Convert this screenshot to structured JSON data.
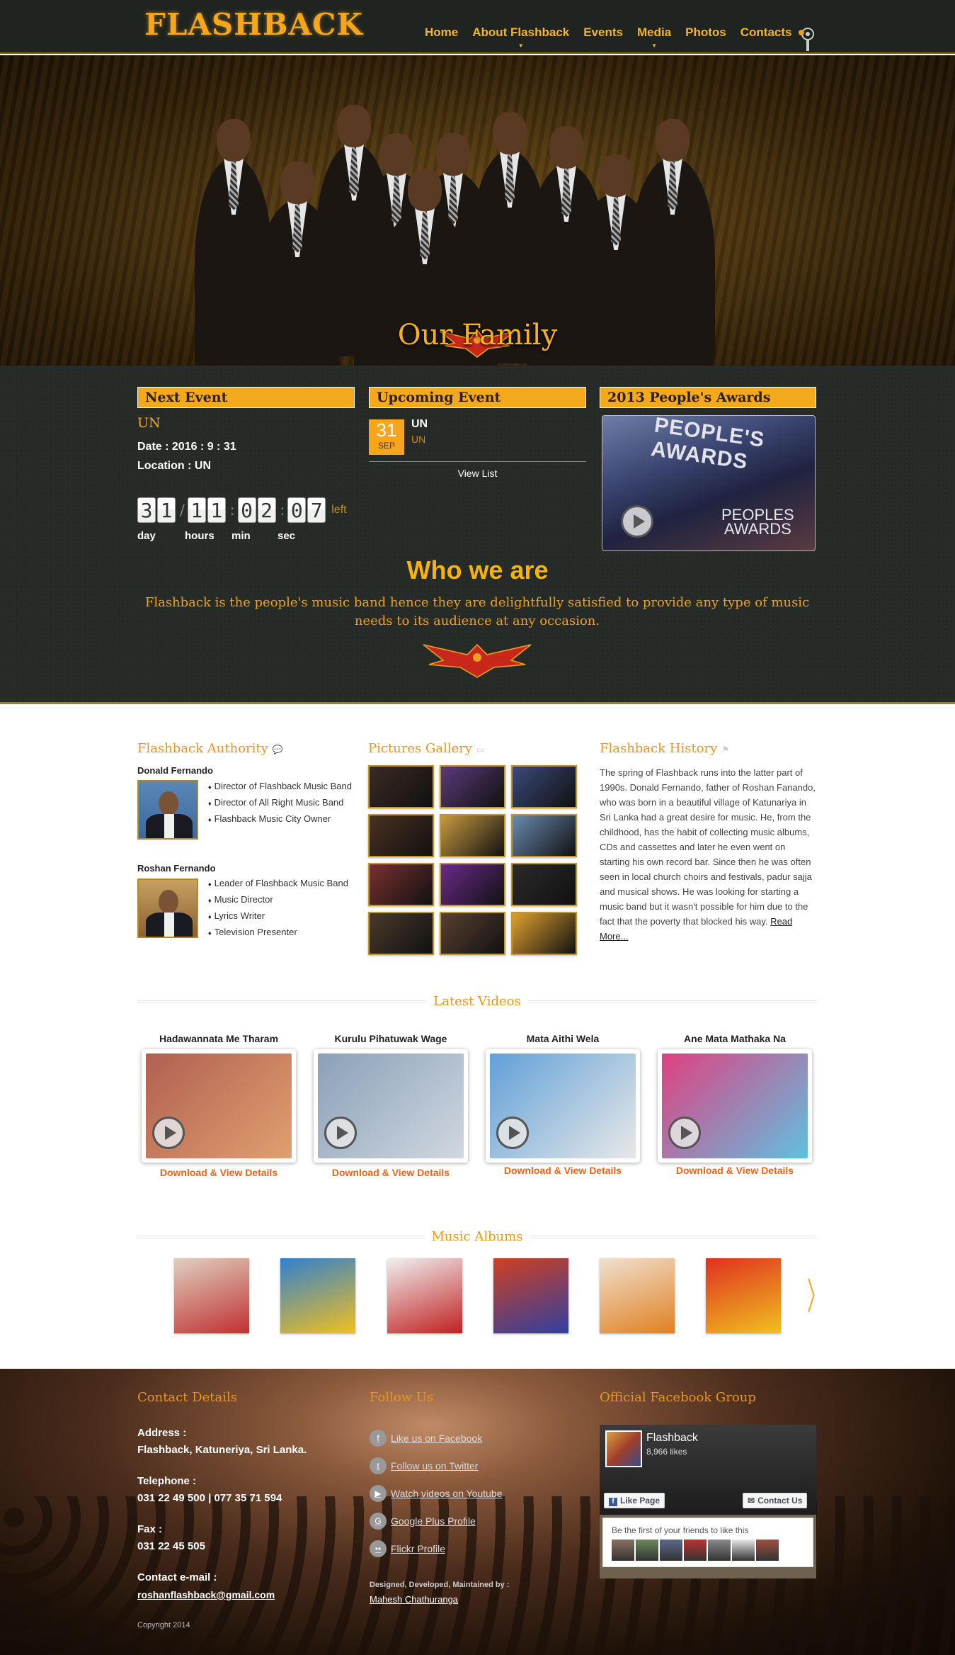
{
  "header": {
    "logo": "FLASHBACK",
    "nav": [
      {
        "label": "Home",
        "dropdown": false
      },
      {
        "label": "About Flashback",
        "dropdown": true
      },
      {
        "label": "Events",
        "dropdown": false
      },
      {
        "label": "Media",
        "dropdown": true
      },
      {
        "label": "Photos",
        "dropdown": false
      },
      {
        "label": "Contacts",
        "dropdown": false
      }
    ],
    "settings_icon": "gear-key-icon"
  },
  "hero": {
    "caption": "Our Family"
  },
  "next_event": {
    "heading": "Next Event",
    "title": "UN",
    "date_label": "Date : 2016 : 9 : 31",
    "location_label": "Location : UN",
    "countdown": {
      "day": [
        "3",
        "1"
      ],
      "hours": [
        "1",
        "1"
      ],
      "min": [
        "0",
        "2"
      ],
      "sec": [
        "0",
        "7"
      ],
      "left": "left",
      "labels": {
        "day": "day",
        "hours": "hours",
        "min": "min",
        "sec": "sec"
      }
    }
  },
  "upcoming_event": {
    "heading": "Upcoming Event",
    "day": "31",
    "month": "SEP",
    "name": "UN",
    "sub": "UN",
    "view_list": "View List"
  },
  "awards": {
    "heading": "2013 People's Awards",
    "thumb_text_top": "PEOPLE'S AWARDS",
    "thumb_text_bottom_1": "PEOPLES",
    "thumb_text_bottom_2": "AWARDS"
  },
  "who": {
    "title": "Who we are",
    "text": "Flashback is the people's music band hence they are delightfully satisfied to provide any type of music needs to its audience at any occasion."
  },
  "authority": {
    "title": "Flashback Authority",
    "people": [
      {
        "name": "Donald Fernando",
        "roles": [
          "Director of Flashback Music Band",
          "Director of All Right Music Band",
          "Flashback Music City Owner"
        ]
      },
      {
        "name": "Roshan Fernando",
        "roles": [
          "Leader of Flashback Music Band",
          "Music Director",
          "Lyrics Writer",
          "Television Presenter"
        ]
      }
    ]
  },
  "gallery": {
    "title": "Pictures Gallery",
    "thumbs": [
      "#3a2a22",
      "#5a3a7a",
      "#3a4a7a",
      "#4a3020",
      "#c89a40",
      "#6a8ab0",
      "#7a3030",
      "#6a2a8a",
      "#2a2a2a",
      "#4a3a2a",
      "#5a4030",
      "#e0a030"
    ]
  },
  "history": {
    "title": "Flashback History",
    "text": "The spring of Flashback runs into the latter part of 1990s. Donald Fernando, father of Roshan Fanando, who was born in a beautiful village of Katunariya in Sri Lanka had a great desire for music. He, from the childhood, has the habit of collecting music albums, CDs and cassettes and later he even went on starting his own record bar. Since then he was often seen in local church choirs and festivals, padur sajja and musical shows. He was looking for starting a music band but it wasn't possible for him due to the fact that the poverty that blocked his way.",
    "read_more": "Read More..."
  },
  "latest_videos": {
    "title": "Latest Videos",
    "link_label": "Download & View Details",
    "items": [
      {
        "title": "Hadawannata Me Tharam",
        "color1": "#b06050",
        "color2": "#e0a070"
      },
      {
        "title": "Kurulu Pihatuwak Wage",
        "color1": "#8aa0b8",
        "color2": "#d0d8e0"
      },
      {
        "title": "Mata Aithi Wela",
        "color1": "#60a0d8",
        "color2": "#e8e8e8"
      },
      {
        "title": "Ane Mata Mathaka Na",
        "color1": "#e04080",
        "color2": "#60c0e0"
      }
    ]
  },
  "albums": {
    "title": "Music Albums",
    "colors": [
      [
        "#e0d0c0",
        "#c03030"
      ],
      [
        "#3080d0",
        "#f0c020"
      ],
      [
        "#f0f0f0",
        "#c02020"
      ],
      [
        "#d04020",
        "#3040a0"
      ],
      [
        "#f0e0d0",
        "#e08020"
      ],
      [
        "#e03020",
        "#f0c020"
      ]
    ]
  },
  "footer": {
    "contact_title": "Contact Details",
    "address_label": "Address :",
    "address": "Flashback, Katuneriya, Sri Lanka.",
    "telephone_label": "Telephone :",
    "telephone": "031 22 49 500 | 077 35 71 594",
    "fax_label": "Fax :",
    "fax": "031 22 45 505",
    "email_label": "Contact e-mail :",
    "email": "roshanflashback@gmail.com",
    "copyright": "Copyright 2014",
    "follow_title": "Follow Us",
    "follow_links": [
      {
        "label": "Like us on Facebook",
        "icon": "facebook-icon",
        "glyph": "f"
      },
      {
        "label": "Follow us on Twitter",
        "icon": "twitter-icon",
        "glyph": "t"
      },
      {
        "label": "Watch videos on Youtube",
        "icon": "youtube-icon",
        "glyph": "▶"
      },
      {
        "label": "Google Plus Profile",
        "icon": "google-plus-icon",
        "glyph": "G"
      },
      {
        "label": "Flickr Profile",
        "icon": "flickr-icon",
        "glyph": "••"
      }
    ],
    "designed_label": "Designed, Developed, Maintained by :",
    "designer": "Mahesh Chathuranga",
    "fb_title": "Official Facebook Group",
    "fb_name": "Flashback",
    "fb_likes": "8,966 likes",
    "fb_like_button": "Like Page",
    "fb_contact_button": "Contact Us",
    "fb_first": "Be the first of your friends to like this"
  }
}
